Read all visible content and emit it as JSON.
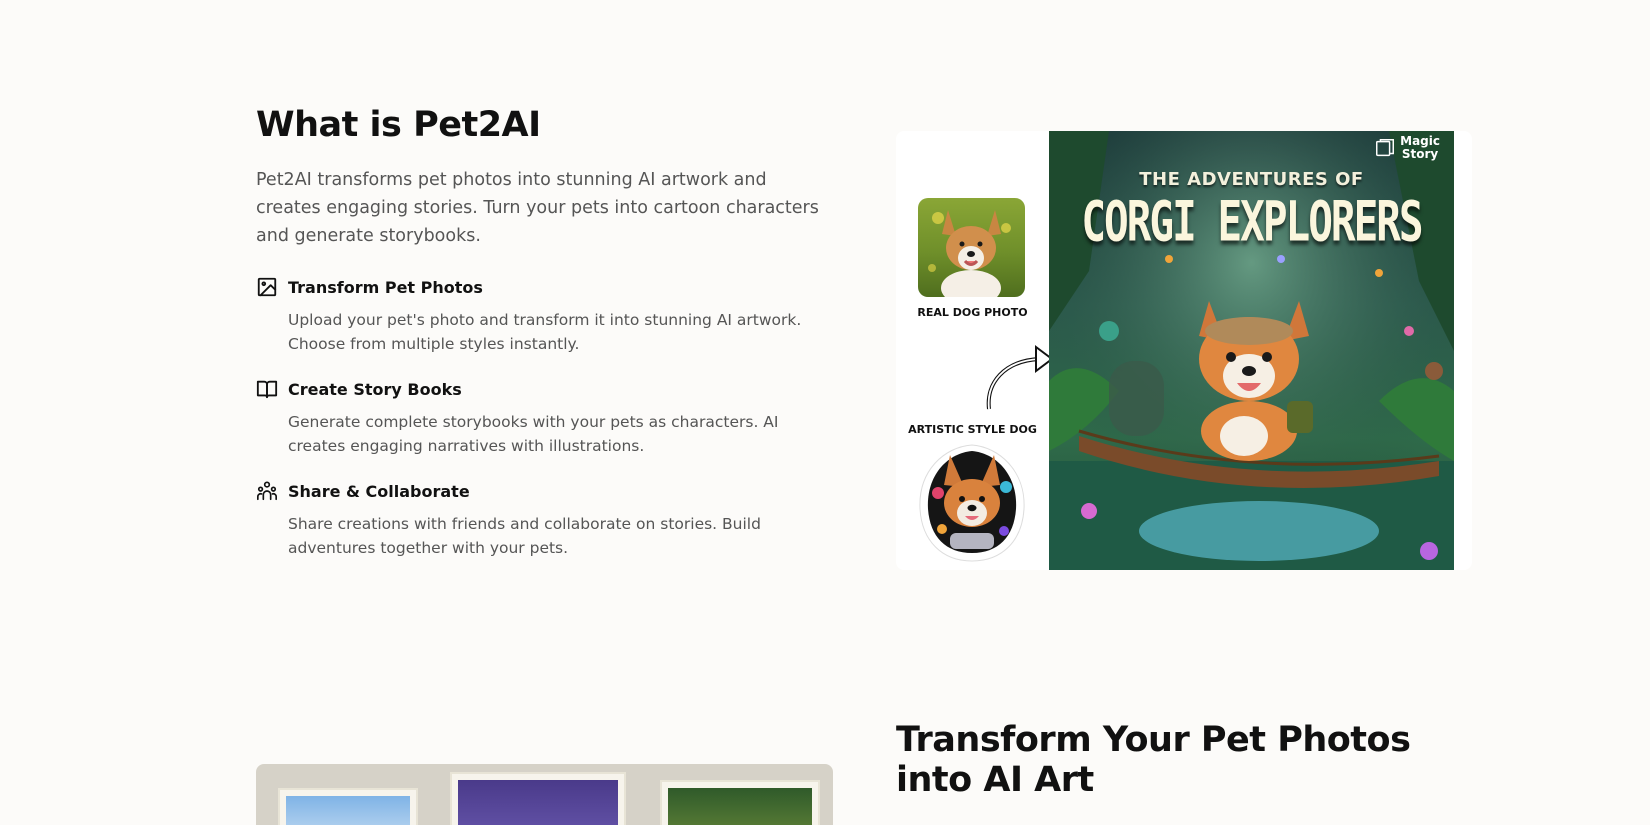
{
  "about": {
    "title": "What is Pet2AI",
    "intro": "Pet2AI transforms pet photos into stunning AI artwork and creates engaging stories. Turn your pets into cartoon characters and generate storybooks.",
    "features": [
      {
        "icon": "image-icon",
        "title": "Transform Pet Photos",
        "desc": "Upload your pet's photo and transform it into stunning AI artwork. Choose from multiple styles instantly."
      },
      {
        "icon": "book-icon",
        "title": "Create Story Books",
        "desc": "Generate complete storybooks with your pets as characters. AI creates engaging narratives with illustrations."
      },
      {
        "icon": "users-icon",
        "title": "Share & Collaborate",
        "desc": "Share creations with friends and collaborate on stories. Build adventures together with your pets."
      }
    ]
  },
  "hero": {
    "real_label": "REAL DOG PHOTO",
    "art_label": "ARTISTIC STYLE DOG",
    "cover_subtitle": "THE ADVENTURES OF",
    "cover_title": "CORGI EXPLORERS",
    "brand_line1": "Magic",
    "brand_line2": "Story"
  },
  "transform": {
    "title": "Transform Your Pet Photos into AI Art"
  },
  "colors": {
    "background": "#fcfbf9",
    "text": "#111111",
    "muted": "#555555"
  }
}
